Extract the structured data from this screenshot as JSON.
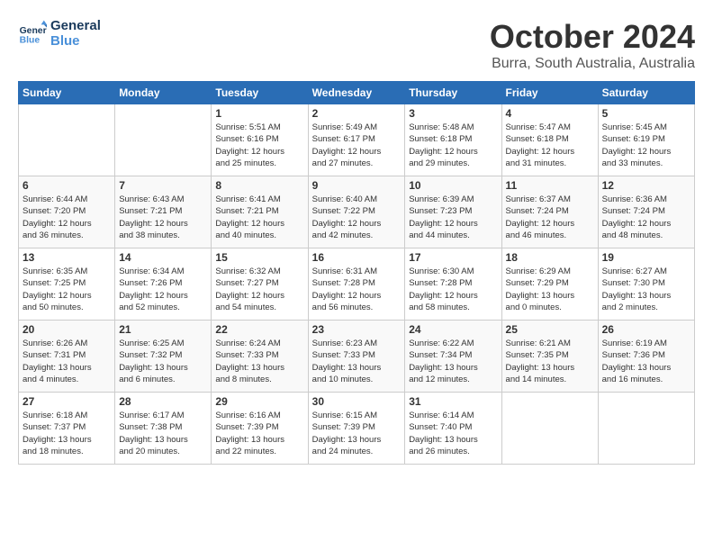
{
  "logo": {
    "line1": "General",
    "line2": "Blue"
  },
  "title": "October 2024",
  "location": "Burra, South Australia, Australia",
  "days_of_week": [
    "Sunday",
    "Monday",
    "Tuesday",
    "Wednesday",
    "Thursday",
    "Friday",
    "Saturday"
  ],
  "weeks": [
    [
      {
        "day": "",
        "info": ""
      },
      {
        "day": "",
        "info": ""
      },
      {
        "day": "1",
        "info": "Sunrise: 5:51 AM\nSunset: 6:16 PM\nDaylight: 12 hours\nand 25 minutes."
      },
      {
        "day": "2",
        "info": "Sunrise: 5:49 AM\nSunset: 6:17 PM\nDaylight: 12 hours\nand 27 minutes."
      },
      {
        "day": "3",
        "info": "Sunrise: 5:48 AM\nSunset: 6:18 PM\nDaylight: 12 hours\nand 29 minutes."
      },
      {
        "day": "4",
        "info": "Sunrise: 5:47 AM\nSunset: 6:18 PM\nDaylight: 12 hours\nand 31 minutes."
      },
      {
        "day": "5",
        "info": "Sunrise: 5:45 AM\nSunset: 6:19 PM\nDaylight: 12 hours\nand 33 minutes."
      }
    ],
    [
      {
        "day": "6",
        "info": "Sunrise: 6:44 AM\nSunset: 7:20 PM\nDaylight: 12 hours\nand 36 minutes."
      },
      {
        "day": "7",
        "info": "Sunrise: 6:43 AM\nSunset: 7:21 PM\nDaylight: 12 hours\nand 38 minutes."
      },
      {
        "day": "8",
        "info": "Sunrise: 6:41 AM\nSunset: 7:21 PM\nDaylight: 12 hours\nand 40 minutes."
      },
      {
        "day": "9",
        "info": "Sunrise: 6:40 AM\nSunset: 7:22 PM\nDaylight: 12 hours\nand 42 minutes."
      },
      {
        "day": "10",
        "info": "Sunrise: 6:39 AM\nSunset: 7:23 PM\nDaylight: 12 hours\nand 44 minutes."
      },
      {
        "day": "11",
        "info": "Sunrise: 6:37 AM\nSunset: 7:24 PM\nDaylight: 12 hours\nand 46 minutes."
      },
      {
        "day": "12",
        "info": "Sunrise: 6:36 AM\nSunset: 7:24 PM\nDaylight: 12 hours\nand 48 minutes."
      }
    ],
    [
      {
        "day": "13",
        "info": "Sunrise: 6:35 AM\nSunset: 7:25 PM\nDaylight: 12 hours\nand 50 minutes."
      },
      {
        "day": "14",
        "info": "Sunrise: 6:34 AM\nSunset: 7:26 PM\nDaylight: 12 hours\nand 52 minutes."
      },
      {
        "day": "15",
        "info": "Sunrise: 6:32 AM\nSunset: 7:27 PM\nDaylight: 12 hours\nand 54 minutes."
      },
      {
        "day": "16",
        "info": "Sunrise: 6:31 AM\nSunset: 7:28 PM\nDaylight: 12 hours\nand 56 minutes."
      },
      {
        "day": "17",
        "info": "Sunrise: 6:30 AM\nSunset: 7:28 PM\nDaylight: 12 hours\nand 58 minutes."
      },
      {
        "day": "18",
        "info": "Sunrise: 6:29 AM\nSunset: 7:29 PM\nDaylight: 13 hours\nand 0 minutes."
      },
      {
        "day": "19",
        "info": "Sunrise: 6:27 AM\nSunset: 7:30 PM\nDaylight: 13 hours\nand 2 minutes."
      }
    ],
    [
      {
        "day": "20",
        "info": "Sunrise: 6:26 AM\nSunset: 7:31 PM\nDaylight: 13 hours\nand 4 minutes."
      },
      {
        "day": "21",
        "info": "Sunrise: 6:25 AM\nSunset: 7:32 PM\nDaylight: 13 hours\nand 6 minutes."
      },
      {
        "day": "22",
        "info": "Sunrise: 6:24 AM\nSunset: 7:33 PM\nDaylight: 13 hours\nand 8 minutes."
      },
      {
        "day": "23",
        "info": "Sunrise: 6:23 AM\nSunset: 7:33 PM\nDaylight: 13 hours\nand 10 minutes."
      },
      {
        "day": "24",
        "info": "Sunrise: 6:22 AM\nSunset: 7:34 PM\nDaylight: 13 hours\nand 12 minutes."
      },
      {
        "day": "25",
        "info": "Sunrise: 6:21 AM\nSunset: 7:35 PM\nDaylight: 13 hours\nand 14 minutes."
      },
      {
        "day": "26",
        "info": "Sunrise: 6:19 AM\nSunset: 7:36 PM\nDaylight: 13 hours\nand 16 minutes."
      }
    ],
    [
      {
        "day": "27",
        "info": "Sunrise: 6:18 AM\nSunset: 7:37 PM\nDaylight: 13 hours\nand 18 minutes."
      },
      {
        "day": "28",
        "info": "Sunrise: 6:17 AM\nSunset: 7:38 PM\nDaylight: 13 hours\nand 20 minutes."
      },
      {
        "day": "29",
        "info": "Sunrise: 6:16 AM\nSunset: 7:39 PM\nDaylight: 13 hours\nand 22 minutes."
      },
      {
        "day": "30",
        "info": "Sunrise: 6:15 AM\nSunset: 7:39 PM\nDaylight: 13 hours\nand 24 minutes."
      },
      {
        "day": "31",
        "info": "Sunrise: 6:14 AM\nSunset: 7:40 PM\nDaylight: 13 hours\nand 26 minutes."
      },
      {
        "day": "",
        "info": ""
      },
      {
        "day": "",
        "info": ""
      }
    ]
  ]
}
